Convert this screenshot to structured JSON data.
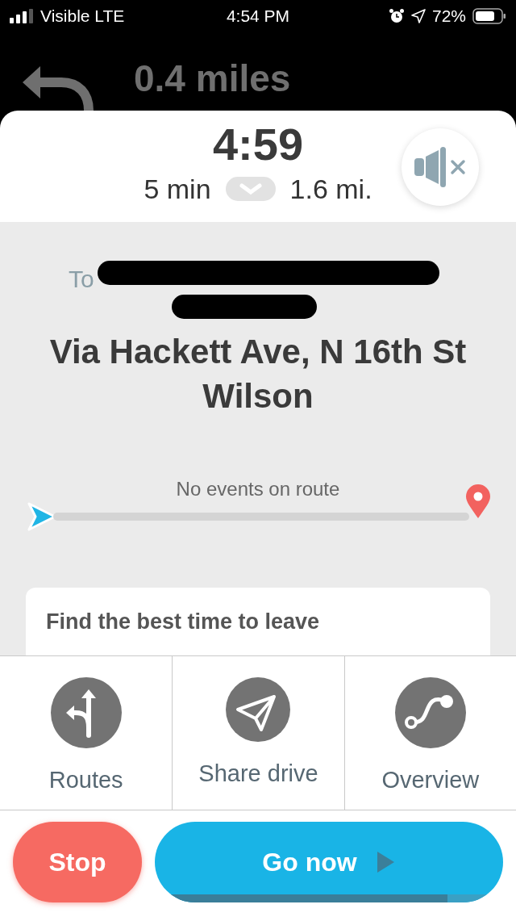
{
  "status_bar": {
    "carrier": "Visible LTE",
    "time": "4:54 PM",
    "battery": "72%"
  },
  "instruction": {
    "distance": "0.4 miles"
  },
  "eta": {
    "arrival": "4:59",
    "duration": "5 min",
    "distance": "1.6 mi.",
    "muted": true
  },
  "destination": {
    "prefix": "To",
    "via": "Via Hackett Ave, N 16th St Wilson"
  },
  "route_events": {
    "label": "No events on route"
  },
  "leave_card": {
    "title": "Find the best time to leave"
  },
  "actions": [
    {
      "kind": "routes",
      "label": "Routes"
    },
    {
      "kind": "share",
      "label": "Share drive"
    },
    {
      "kind": "overview",
      "label": "Overview"
    }
  ],
  "stop_button": {
    "label": "Stop"
  },
  "go_button": {
    "label": "Go now",
    "level": 0.84
  }
}
